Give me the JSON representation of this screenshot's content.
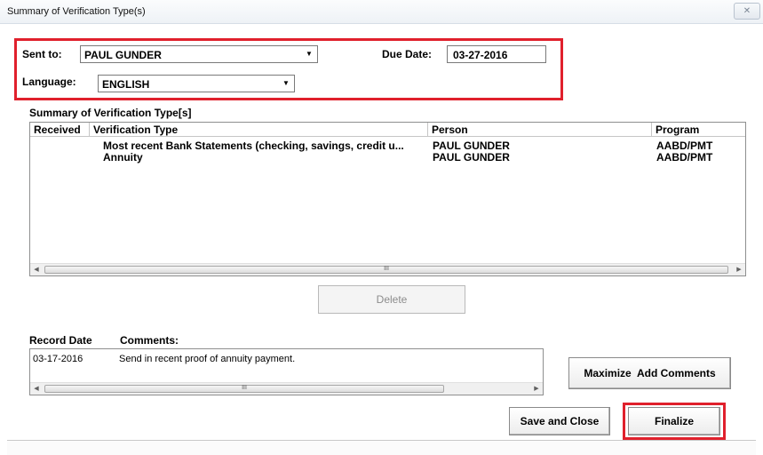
{
  "window": {
    "title": "Summary of Verification Type(s)",
    "close_glyph": "✕"
  },
  "header": {
    "sent_to_label": "Sent to:",
    "sent_to_value": "PAUL GUNDER",
    "due_date_label": "Due Date:",
    "due_date_value": "03-27-2016",
    "language_label": "Language:",
    "language_value": "ENGLISH"
  },
  "summary": {
    "heading": "Summary of Verification Type[s]",
    "columns": [
      "Received",
      "Verification Type",
      "Person",
      "Program"
    ],
    "rows": [
      {
        "received": "",
        "type": "Most recent Bank Statements (checking, savings, credit u...",
        "person": "PAUL GUNDER",
        "program": "AABD/PMT"
      },
      {
        "received": "",
        "type": "Annuity",
        "person": "PAUL GUNDER",
        "program": "AABD/PMT"
      }
    ],
    "scroll_thumb_grip": "III"
  },
  "buttons": {
    "delete": "Delete",
    "maximize_add_comments": "Maximize  Add Comments",
    "save_and_close": "Save and Close",
    "finalize": "Finalize"
  },
  "comments": {
    "record_date_label": "Record Date",
    "comments_label": "Comments:",
    "rows": [
      {
        "date": "03-17-2016",
        "text": "Send in recent proof of annuity payment."
      }
    ],
    "scroll_thumb_grip": "III"
  },
  "highlight_color": "#e0202c"
}
